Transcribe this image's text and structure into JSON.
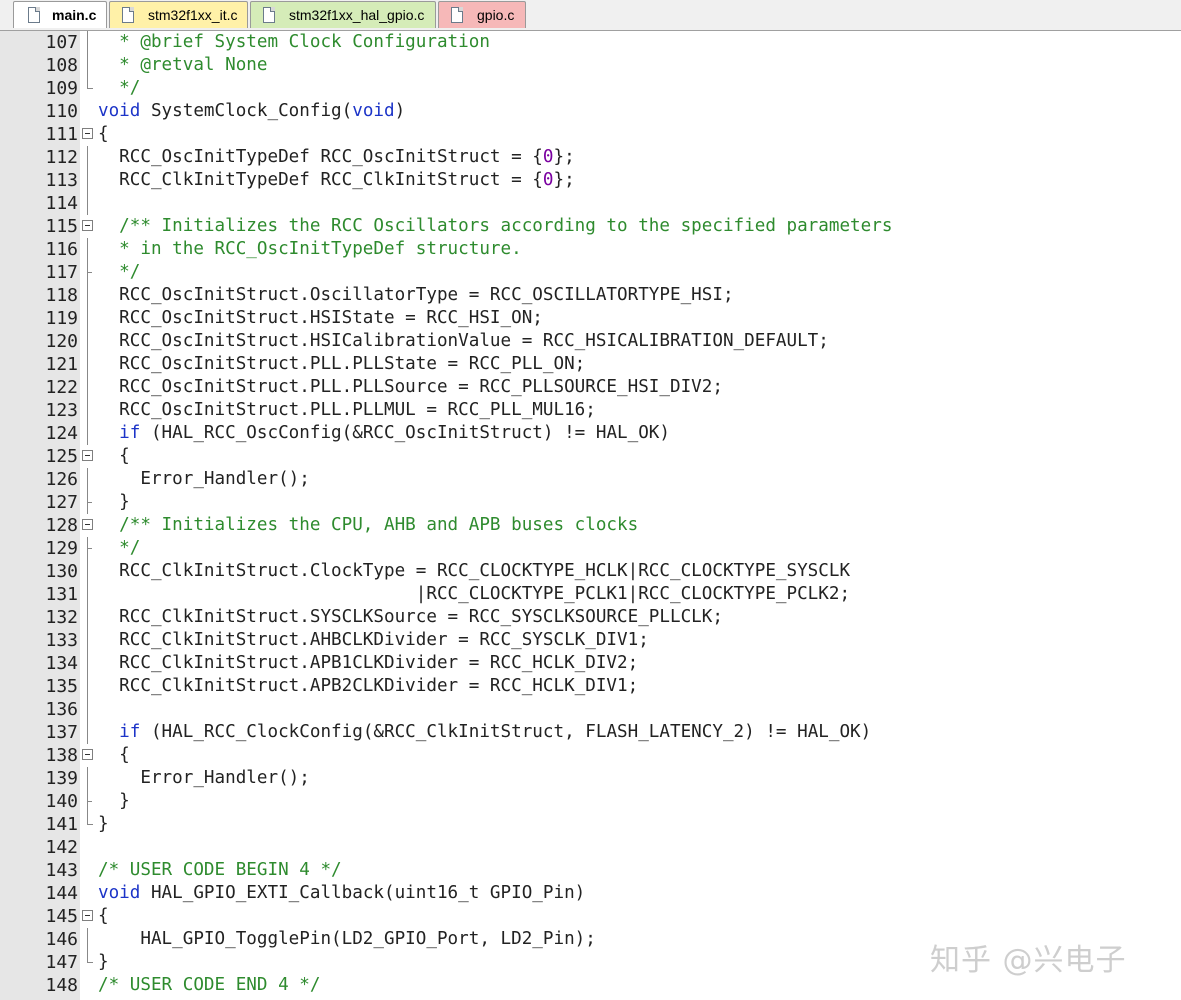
{
  "tabs": [
    {
      "label": "main.c",
      "active": true
    },
    {
      "label": "stm32f1xx_it.c",
      "active": false
    },
    {
      "label": "stm32f1xx_hal_gpio.c",
      "active": false
    },
    {
      "label": "gpio.c",
      "active": false
    }
  ],
  "colors": {
    "keyword": "#1c34c8",
    "comment": "#2e8b2e",
    "number": "#7a00a0",
    "text": "#222222",
    "gutter": "#e6e6e6"
  },
  "lines": [
    {
      "n": "107",
      "fold": "vbar",
      "tokens": [
        [
          "cm",
          "  * @brief System Clock Configuration"
        ]
      ]
    },
    {
      "n": "108",
      "fold": "vbar",
      "tokens": [
        [
          "cm",
          "  * @retval None"
        ]
      ]
    },
    {
      "n": "109",
      "fold": "end",
      "tokens": [
        [
          "cm",
          "  */"
        ]
      ]
    },
    {
      "n": "110",
      "fold": "",
      "tokens": [
        [
          "kw",
          "void"
        ],
        [
          "",
          " SystemClock_Config("
        ],
        [
          "kw",
          "void"
        ],
        [
          "",
          ")"
        ]
      ]
    },
    {
      "n": "111",
      "fold": "box",
      "tokens": [
        [
          "",
          "{"
        ]
      ]
    },
    {
      "n": "112",
      "fold": "vbar",
      "tokens": [
        [
          "",
          "  RCC_OscInitTypeDef RCC_OscInitStruct = {"
        ],
        [
          "num",
          "0"
        ],
        [
          "",
          "};"
        ]
      ]
    },
    {
      "n": "113",
      "fold": "vbar",
      "tokens": [
        [
          "",
          "  RCC_ClkInitTypeDef RCC_ClkInitStruct = {"
        ],
        [
          "num",
          "0"
        ],
        [
          "",
          "};"
        ]
      ]
    },
    {
      "n": "114",
      "fold": "vbar",
      "tokens": [
        [
          "",
          ""
        ]
      ]
    },
    {
      "n": "115",
      "fold": "box",
      "tokens": [
        [
          "cm",
          "  /** Initializes the RCC Oscillators according to the specified parameters"
        ]
      ]
    },
    {
      "n": "116",
      "fold": "vbar",
      "tokens": [
        [
          "cm",
          "  * in the RCC_OscInitTypeDef structure."
        ]
      ]
    },
    {
      "n": "117",
      "fold": "tick",
      "tokens": [
        [
          "cm",
          "  */"
        ]
      ]
    },
    {
      "n": "118",
      "fold": "vbar",
      "tokens": [
        [
          "",
          "  RCC_OscInitStruct.OscillatorType = RCC_OSCILLATORTYPE_HSI;"
        ]
      ]
    },
    {
      "n": "119",
      "fold": "vbar",
      "tokens": [
        [
          "",
          "  RCC_OscInitStruct.HSIState = RCC_HSI_ON;"
        ]
      ]
    },
    {
      "n": "120",
      "fold": "vbar",
      "tokens": [
        [
          "",
          "  RCC_OscInitStruct.HSICalibrationValue = RCC_HSICALIBRATION_DEFAULT;"
        ]
      ]
    },
    {
      "n": "121",
      "fold": "vbar",
      "tokens": [
        [
          "",
          "  RCC_OscInitStruct.PLL.PLLState = RCC_PLL_ON;"
        ]
      ]
    },
    {
      "n": "122",
      "fold": "vbar",
      "tokens": [
        [
          "",
          "  RCC_OscInitStruct.PLL.PLLSource = RCC_PLLSOURCE_HSI_DIV2;"
        ]
      ]
    },
    {
      "n": "123",
      "fold": "vbar",
      "tokens": [
        [
          "",
          "  RCC_OscInitStruct.PLL.PLLMUL = RCC_PLL_MUL16;"
        ]
      ]
    },
    {
      "n": "124",
      "fold": "vbar",
      "tokens": [
        [
          "kw",
          "  if"
        ],
        [
          "",
          " (HAL_RCC_OscConfig(&RCC_OscInitStruct) != HAL_OK)"
        ]
      ]
    },
    {
      "n": "125",
      "fold": "box",
      "tokens": [
        [
          "",
          "  {"
        ]
      ]
    },
    {
      "n": "126",
      "fold": "vbar",
      "tokens": [
        [
          "",
          "    Error_Handler();"
        ]
      ]
    },
    {
      "n": "127",
      "fold": "tick",
      "tokens": [
        [
          "",
          "  }"
        ]
      ]
    },
    {
      "n": "128",
      "fold": "box",
      "tokens": [
        [
          "cm",
          "  /** Initializes the CPU, AHB and APB buses clocks"
        ]
      ]
    },
    {
      "n": "129",
      "fold": "tick",
      "tokens": [
        [
          "cm",
          "  */"
        ]
      ]
    },
    {
      "n": "130",
      "fold": "vbar",
      "tokens": [
        [
          "",
          "  RCC_ClkInitStruct.ClockType = RCC_CLOCKTYPE_HCLK|RCC_CLOCKTYPE_SYSCLK"
        ]
      ]
    },
    {
      "n": "131",
      "fold": "vbar",
      "tokens": [
        [
          "",
          "                              |RCC_CLOCKTYPE_PCLK1|RCC_CLOCKTYPE_PCLK2;"
        ]
      ]
    },
    {
      "n": "132",
      "fold": "vbar",
      "tokens": [
        [
          "",
          "  RCC_ClkInitStruct.SYSCLKSource = RCC_SYSCLKSOURCE_PLLCLK;"
        ]
      ]
    },
    {
      "n": "133",
      "fold": "vbar",
      "tokens": [
        [
          "",
          "  RCC_ClkInitStruct.AHBCLKDivider = RCC_SYSCLK_DIV1;"
        ]
      ]
    },
    {
      "n": "134",
      "fold": "vbar",
      "tokens": [
        [
          "",
          "  RCC_ClkInitStruct.APB1CLKDivider = RCC_HCLK_DIV2;"
        ]
      ]
    },
    {
      "n": "135",
      "fold": "vbar",
      "tokens": [
        [
          "",
          "  RCC_ClkInitStruct.APB2CLKDivider = RCC_HCLK_DIV1;"
        ]
      ]
    },
    {
      "n": "136",
      "fold": "vbar",
      "tokens": [
        [
          "",
          ""
        ]
      ]
    },
    {
      "n": "137",
      "fold": "vbar",
      "tokens": [
        [
          "kw",
          "  if"
        ],
        [
          "",
          " (HAL_RCC_ClockConfig(&RCC_ClkInitStruct, FLASH_LATENCY_2) != HAL_OK)"
        ]
      ]
    },
    {
      "n": "138",
      "fold": "box",
      "tokens": [
        [
          "",
          "  {"
        ]
      ]
    },
    {
      "n": "139",
      "fold": "vbar",
      "tokens": [
        [
          "",
          "    Error_Handler();"
        ]
      ]
    },
    {
      "n": "140",
      "fold": "tick",
      "tokens": [
        [
          "",
          "  }"
        ]
      ]
    },
    {
      "n": "141",
      "fold": "end",
      "tokens": [
        [
          "",
          "}"
        ]
      ]
    },
    {
      "n": "142",
      "fold": "",
      "tokens": [
        [
          "",
          ""
        ]
      ]
    },
    {
      "n": "143",
      "fold": "",
      "tokens": [
        [
          "cm",
          "/* USER CODE BEGIN 4 */"
        ]
      ]
    },
    {
      "n": "144",
      "fold": "",
      "tokens": [
        [
          "kw",
          "void"
        ],
        [
          "",
          " HAL_GPIO_EXTI_Callback(uint16_t GPIO_Pin)"
        ]
      ]
    },
    {
      "n": "145",
      "fold": "box",
      "tokens": [
        [
          "",
          "{"
        ]
      ]
    },
    {
      "n": "146",
      "fold": "vbar",
      "tokens": [
        [
          "",
          "    HAL_GPIO_TogglePin(LD2_GPIO_Port, LD2_Pin);"
        ]
      ]
    },
    {
      "n": "147",
      "fold": "end",
      "tokens": [
        [
          "",
          "}"
        ]
      ]
    },
    {
      "n": "148",
      "fold": "",
      "tokens": [
        [
          "cm",
          "/* USER CODE END 4 */"
        ]
      ]
    }
  ],
  "watermark": "知乎 @兴电子"
}
